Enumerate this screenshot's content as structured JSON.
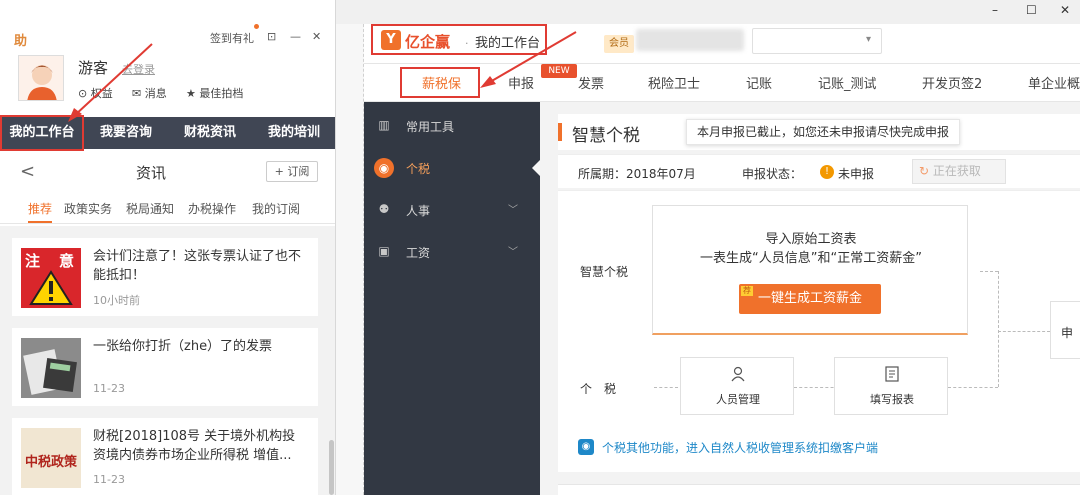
{
  "left_panel": {
    "brand": "助",
    "sign_in": "签到有礼",
    "window_icons": [
      "⊡",
      "—",
      "✕"
    ],
    "user_name": "游客",
    "logout": "去登录",
    "mini_items": [
      {
        "icon": "⊙",
        "label": "权益"
      },
      {
        "icon": "✉",
        "label": "消息"
      },
      {
        "icon": "★",
        "label": "最佳拍档"
      }
    ],
    "nav_tabs": [
      "我的工作台",
      "我要咨询",
      "财税资讯",
      "我的培训"
    ],
    "sub_title": "资讯",
    "back": "<",
    "subscribe": "+ 订阅",
    "categories": [
      "推荐",
      "政策实务",
      "税局通知",
      "办税操作",
      "我的订阅"
    ],
    "articles": [
      {
        "title": "会计们注意了！这张专票认证了也不能抵扣！",
        "time": "10小时前",
        "thumb_text": "注 意"
      },
      {
        "title": "一张给你打折（zhe）了的发票",
        "time": "11-23",
        "thumb_text": ""
      },
      {
        "title": "财税[2018]108号 关于境外机构投资境内债券市场企业所得税 增值...",
        "time": "11-23",
        "thumb_text": "中税政策"
      }
    ]
  },
  "window": {
    "controls": [
      "–",
      "☐",
      "✕"
    ]
  },
  "topbar": {
    "brand_logo": "Y",
    "brand_name": "亿企赢",
    "brand_sep": "·",
    "brand_page": "我的工作台",
    "vip_label": "会员",
    "company_caret": "▾"
  },
  "menu": {
    "tabs": [
      "薪税保",
      "申报",
      "发票",
      "税险卫士",
      "记账",
      "记账_测试",
      "开发页签2",
      "单企业概"
    ],
    "new_badge": "NEW"
  },
  "sidebar": {
    "items": [
      {
        "icon": "▥",
        "label": "常用工具",
        "chevron": ""
      },
      {
        "icon": "◉",
        "label": "个税",
        "chevron": ""
      },
      {
        "icon": "⚉",
        "label": "人事",
        "chevron": "﹀"
      },
      {
        "icon": "▣",
        "label": "工资",
        "chevron": "﹀"
      }
    ]
  },
  "main": {
    "section_title": "智慧个税",
    "tooltip": "本月申报已截止，如您还未申报请尽快完成申报",
    "period_label": "所属期：2018年07月",
    "status_label": "申报状态：",
    "status_value": "未申报",
    "fetch_button": "正在获取",
    "flow_label_smart": "智慧个税",
    "flow_label_tax": "个　税",
    "card_line1": "导入原始工资表",
    "card_line2": "一表生成“人员信息”和“正常工资薪金”",
    "gen_button": "一键生成工资薪金",
    "gen_tag": "荐",
    "box1_label": "人员管理",
    "box2_label": "填写报表",
    "edge_text": "申",
    "footer_link": "个税其他功能，进入自然人税收管理系统扣缴客户端"
  },
  "colors": {
    "accent": "#f0712b",
    "dark_sidebar": "#323843",
    "left_nav": "#404654",
    "annotation": "#e03b33",
    "link": "#1e88c8"
  }
}
